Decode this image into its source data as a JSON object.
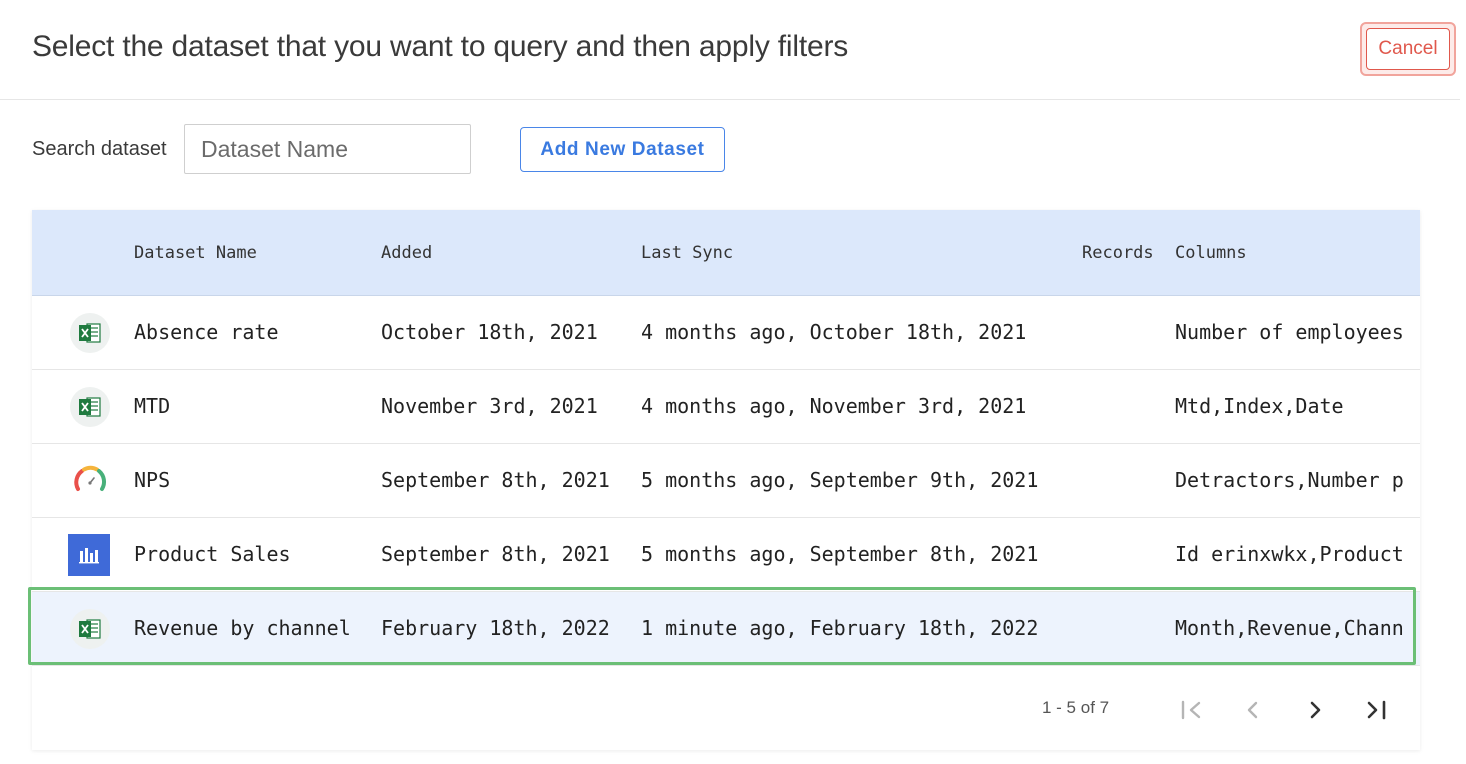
{
  "header": {
    "title": "Select the dataset that you want to query and then apply filters",
    "cancel_label": "Cancel"
  },
  "search": {
    "label": "Search dataset",
    "placeholder": "Dataset Name",
    "value": ""
  },
  "add_button_label": "Add New Dataset",
  "table": {
    "headers": {
      "name": "Dataset Name",
      "added": "Added",
      "last_sync": "Last Sync",
      "records": "Records",
      "columns": "Columns"
    },
    "rows": [
      {
        "icon": "excel-icon",
        "name": "Absence rate",
        "added": "October 18th, 2021",
        "last_sync": "4 months ago, October 18th, 2021",
        "records": "",
        "columns": "Number of employees"
      },
      {
        "icon": "excel-icon",
        "name": "MTD",
        "added": "November 3rd, 2021",
        "last_sync": "4 months ago, November 3rd, 2021",
        "records": "",
        "columns": "Mtd,Index,Date"
      },
      {
        "icon": "gauge-icon",
        "name": "NPS",
        "added": "September 8th, 2021",
        "last_sync": "5 months ago, September 9th, 2021",
        "records": "",
        "columns": "Detractors,Number p"
      },
      {
        "icon": "bar-chart-icon",
        "name": "Product Sales",
        "added": "September 8th, 2021",
        "last_sync": "5 months ago, September 8th, 2021",
        "records": "",
        "columns": "Id erinxwkx,Product"
      },
      {
        "icon": "excel-icon",
        "name": "Revenue by channel",
        "added": "February 18th, 2022",
        "last_sync": "1 minute ago, February 18th, 2022",
        "records": "",
        "columns": "Month,Revenue,Chann",
        "selected": true
      }
    ]
  },
  "pagination": {
    "range_text": "1 - 5 of 7"
  },
  "colors": {
    "header_bg": "#dce8fb",
    "accent_blue": "#4a86e8",
    "cancel_red": "#e0584c",
    "selected_outline": "#6bbf76",
    "excel_green": "#1f7a3f"
  }
}
